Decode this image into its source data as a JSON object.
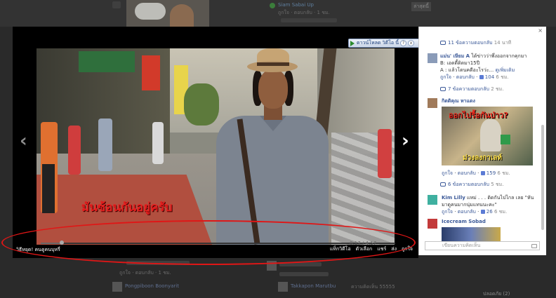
{
  "background": {
    "top_right_item": "Siam Sabai Up",
    "top_right_meta": "ถูกใจ · ตอบกลับ · 1 ชม.",
    "top_right_badge": "ล่าสุดนี้",
    "bottom_left_text": "ถูกใจ · ตอบกลับ · 1 ชม.",
    "bottom_left_name": "Pongpiboon Boonyarit",
    "bottom_right_name": "Takkapon Marutbu",
    "bottom_right_meta": "ความคิดเห็น 55555",
    "bottom_far_right": "ปลอดภัย (2)"
  },
  "video": {
    "subtitle": "มันซ้อนกันอยู่ครับ",
    "caption": "วิธีหยุด! คนดูคนบุหรี่",
    "time": "0:17 / 4:57",
    "progress_fraction": 0.06,
    "actions": {
      "tag": "แท็กวิดีโอ",
      "options": "ตัวเลือก",
      "share": "แชร์",
      "send": "ส่ง",
      "like": "ถูกใจ"
    },
    "download_label": "ดาวน์โหลด วิดีโอ นี้",
    "download_help": "?",
    "download_close": "x",
    "prev_icon": "‹",
    "next_icon": "›"
  },
  "panel": {
    "close": "×",
    "replies_1": "11 ข้อความตอบกลับ",
    "replies_1_time": "14 นาที",
    "comment_a": {
      "name": "แม่น' เษียม A",
      "text_1": "ได้ข่าวว่าพึ่งออกจากคุกมา",
      "text_2": "B: เอดดี้ดิดมา15ปี",
      "text_3": "A : แล้วโดนคดีอะไรว่ะ...",
      "see_more": "ดูเพิ่มเติม",
      "like": "ถูกใจ",
      "reply": "ตอบกลับ",
      "likes": "104",
      "time": "6 ชม."
    },
    "replies_2": "7 ข้อความตอบกลับ",
    "replies_2_time": "2 ชม.",
    "comment_b": {
      "name": "กิตติคุณ หาแดง",
      "poster_top": "ออกไปรื้อกันป่าว?",
      "poster_bottom": "ม่วงลงกาเลท์",
      "like": "ถูกใจ",
      "reply": "ตอบกลับ",
      "likes": "159",
      "time": "6 ชม."
    },
    "replies_3": "6 ข้อความตอบกลับ",
    "replies_3_time": "5 ชม.",
    "comment_c": {
      "name": "Kim Lilly",
      "text_1": "แหม่ . . . ติดกันไปไกล เลย \"หัน",
      "text_2": "มาดูคนมากนุ่มแทนนะคะ\"",
      "like": "ถูกใจ",
      "reply": "ตอบกลับ",
      "likes": "26",
      "time": "6 ชม."
    },
    "comment_d_name": "Icecream Sobad",
    "input_placeholder": "เขียนความคิดเห็น"
  },
  "colors": {
    "highlight": "#e01616",
    "link": "#3b5998",
    "subtitle": "#e51e1e"
  }
}
